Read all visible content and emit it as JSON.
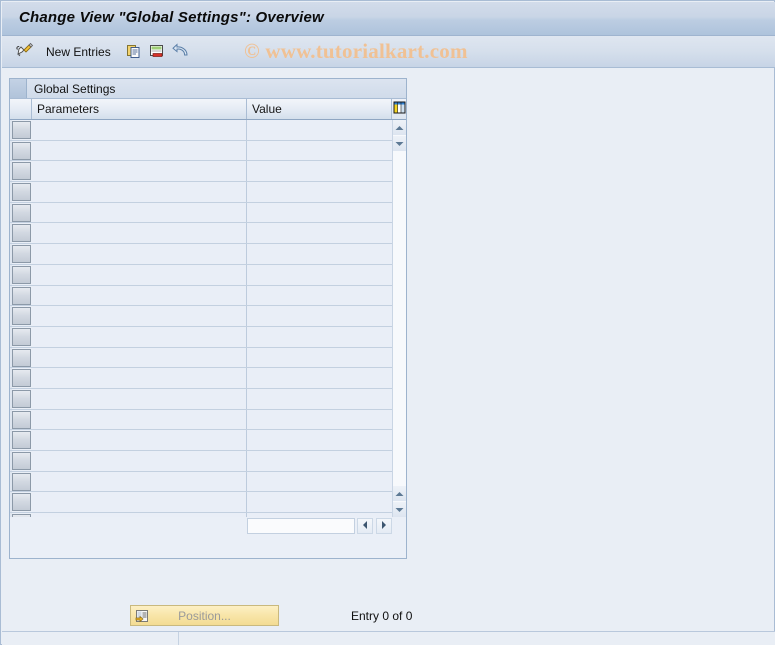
{
  "window": {
    "title": "Change View \"Global Settings\": Overview"
  },
  "toolbar": {
    "display_change_icon": "pencil-display-change-icon",
    "new_entries_label": "New Entries",
    "copy_icon": "copy-as-icon",
    "delete_icon": "delete-row-icon",
    "undo_icon": "undo-change-icon"
  },
  "watermark": {
    "text": "© www.tutorialkart.com",
    "color": "#f0c194"
  },
  "table": {
    "panel_title": "Global Settings",
    "columns": [
      {
        "key": "select",
        "label": ""
      },
      {
        "key": "parameters",
        "label": "Parameters"
      },
      {
        "key": "value",
        "label": "Value"
      }
    ],
    "config_columns_icon": "table-settings-icon",
    "rows": [],
    "empty_row_count": 20,
    "vertical_scrollbar": {
      "up_icon": "scroll-up-icon",
      "down_icon": "scroll-down-icon",
      "page_up_icon": "scroll-page-up-icon",
      "page_down_icon": "scroll-page-down-icon"
    },
    "horizontal_scrollbar": {
      "left_icon": "scroll-left-icon",
      "right_icon": "scroll-right-icon",
      "value": ""
    }
  },
  "footer": {
    "position_button_label": "Position...",
    "position_button_icon": "position-find-icon",
    "entry_count_text": "Entry 0 of 0"
  },
  "status_bar": {
    "message": ""
  },
  "colors": {
    "title_bar": "#bccde2",
    "panel_background": "#eaeff7",
    "row_background": "#e9eef7",
    "grid_line": "#c3d0e0",
    "accent_border": "#9db3cd",
    "position_button": "#f8e5a8"
  }
}
